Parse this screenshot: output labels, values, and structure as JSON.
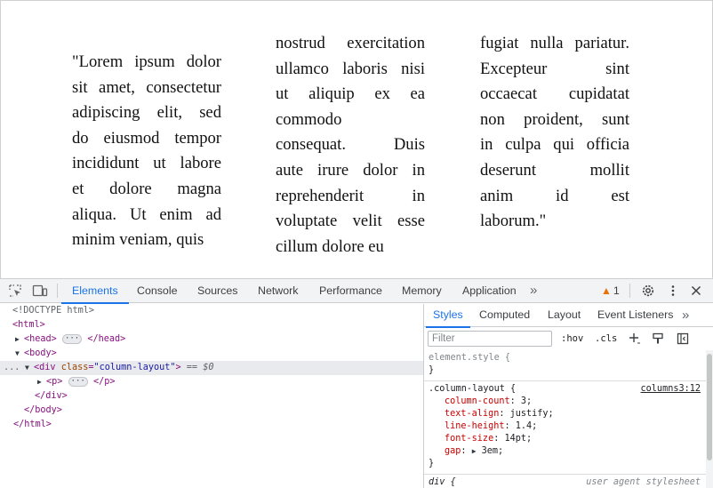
{
  "page": {
    "columns": [
      {
        "lines": [
          "\"Lorem ipsum dolor",
          "sit amet, consectetur",
          "adipiscing elit, sed",
          "do eiusmod tempor",
          "incididunt ut labore",
          "et dolore magna",
          "aliqua. Ut enim ad",
          "minim veniam, quis"
        ]
      },
      {
        "lines": [
          "nostrud exercitation",
          "ullamco laboris nisi",
          "ut aliquip ex ea",
          "commodo",
          "consequat. Duis",
          "aute irure dolor in",
          "reprehenderit in",
          "voluptate velit esse",
          "cillum dolore eu"
        ]
      },
      {
        "lines": [
          "fugiat nulla pariatur.",
          "Excepteur sint",
          "occaecat cupidatat",
          "non proident, sunt",
          "in culpa qui officia",
          "deserunt mollit",
          "anim id est",
          "laborum.\""
        ]
      }
    ]
  },
  "devtools": {
    "toolbar": {
      "inspect_icon": "element-picker-icon",
      "device_icon": "device-toolbar-icon",
      "tabs": [
        "Elements",
        "Console",
        "Sources",
        "Network",
        "Performance",
        "Memory",
        "Application"
      ],
      "more_tabs": "»",
      "warning_count": "1",
      "warning_icon": "warning-triangle-icon",
      "settings_icon": "gear-icon",
      "menu_icon": "vertical-dots-icon",
      "close_icon": "close-icon",
      "accent_color": "#1a73e8",
      "warning_color": "#e8710a"
    },
    "dom": {
      "doctype": "<!DOCTYPE html>",
      "html_open": "<html>",
      "head": "<head>",
      "head_close": "</head>",
      "body_open": "<body>",
      "div_tag": "div",
      "div_attr_name": "class",
      "div_attr_value": "\"column-layout\"",
      "selected_marker": "== $0",
      "p_open": "<p>",
      "p_close": "</p>",
      "ellipsis": "···",
      "div_close": "</div>",
      "body_close": "</body>",
      "html_close": "</html>",
      "row_dots": "..."
    },
    "styles_pane": {
      "tabs": [
        "Styles",
        "Computed",
        "Layout",
        "Event Listeners"
      ],
      "more_tabs": "»",
      "filter_placeholder": "Filter",
      "filter_value": "",
      "hov": ":hov",
      "cls": ".cls",
      "add_icon": "plus-icon",
      "paint_icon": "paint-brush-icon",
      "sidebar_icon": "toggle-sidebar-icon",
      "element_style": {
        "selector": "element.style {",
        "close": "}"
      },
      "column_layout_rule": {
        "selector": ".column-layout {",
        "source": "columns3:12",
        "declarations": [
          {
            "name": "column-count",
            "value": "3;"
          },
          {
            "name": "text-align",
            "value": "justify;"
          },
          {
            "name": "line-height",
            "value": "1.4;"
          },
          {
            "name": "font-size",
            "value": "14pt;"
          },
          {
            "name": "gap",
            "value": "3em;",
            "expander": "▶"
          }
        ],
        "close": "}"
      },
      "ua_rule": {
        "selector": "div {",
        "source": "user agent stylesheet"
      }
    }
  }
}
